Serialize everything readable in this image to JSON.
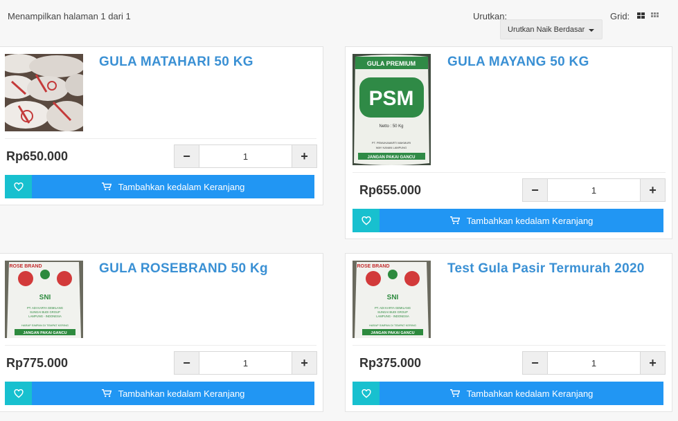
{
  "toolbar": {
    "showing": "Menampilkan halaman 1 dari 1",
    "sort_label": "Urutkan:",
    "sort_value": "Urutkan Naik Berdasarkan",
    "grid_label": "Grid:"
  },
  "colors": {
    "accent": "#2196f3",
    "wishlist": "#18c0cf",
    "title": "#3a90d4"
  },
  "products": [
    {
      "title": "GULA MATAHARI 50 KG",
      "price": "Rp650.000",
      "qty": "1",
      "cart_label": "Tambahkan kedalam Keranjang"
    },
    {
      "title": "GULA MAYANG 50 KG",
      "price": "Rp655.000",
      "qty": "1",
      "cart_label": "Tambahkan kedalam Keranjang"
    },
    {
      "title": "GULA ROSEBRAND 50 Kg",
      "price": "Rp775.000",
      "qty": "1",
      "cart_label": "Tambahkan kedalam Keranjang"
    },
    {
      "title": "Test Gula Pasir Termurah 2020",
      "price": "Rp375.000",
      "qty": "1",
      "cart_label": "Tambahkan kedalam Keranjang"
    }
  ],
  "images": {
    "psm": {
      "brand_top": "GULA PREMIUM",
      "brand": "PSM",
      "netto": "Netto : 50 Kg",
      "maker": "PT. PEMUKAMARTI MAKMURI",
      "loc": "WAY KANAN LAMPUNG",
      "warning": "JANGAN PAKAI GANCU"
    },
    "rose": {
      "brand": "ROSE BRAND",
      "sni": "SNI",
      "maker": "PT. ADI KARYA GEMILANG",
      "group": "SUNGAI BUDI GROUP",
      "loc": "LAMPUNG - INDONESIA",
      "store": "HARAP SIMPAN DI TEMPAT KERING",
      "warning": "JANGAN PAKAI GANCU"
    }
  }
}
